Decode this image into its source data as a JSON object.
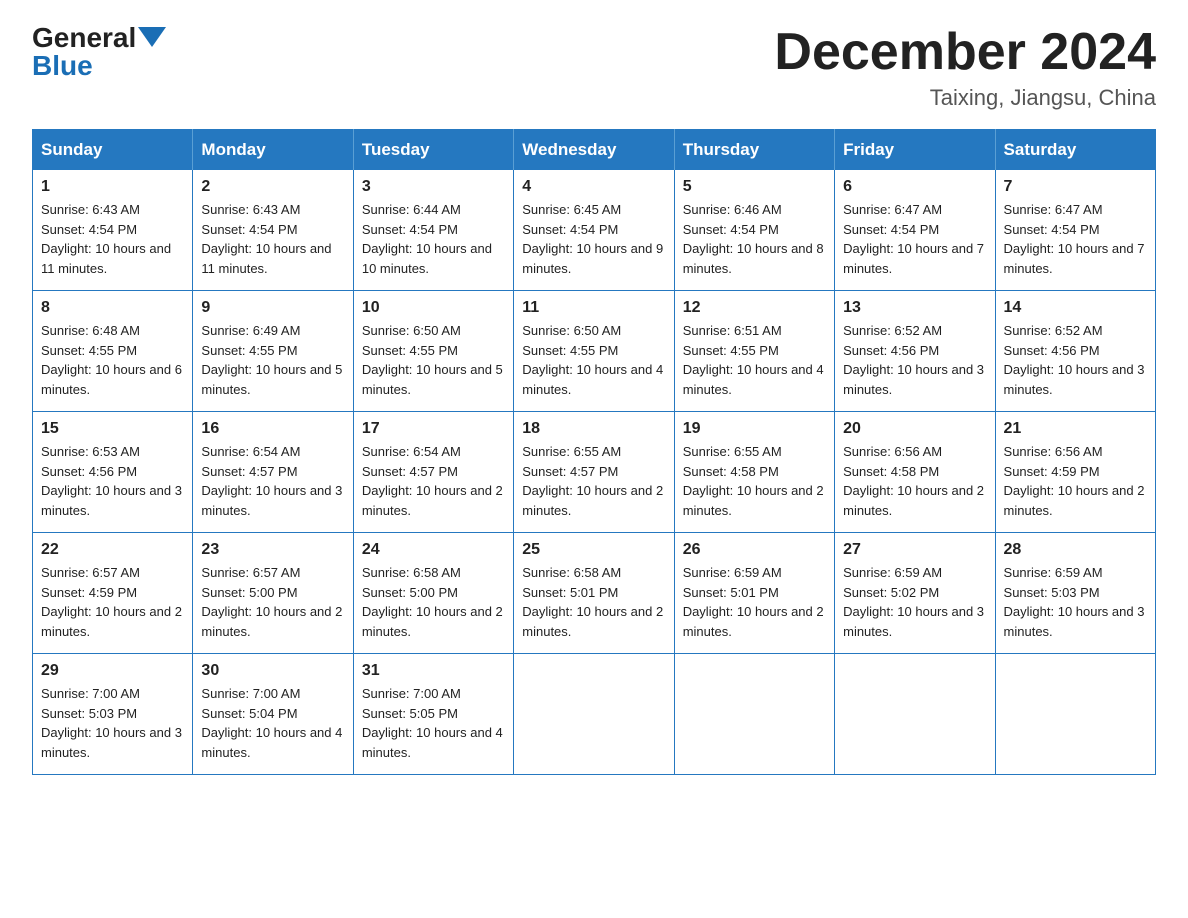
{
  "header": {
    "logo_general": "General",
    "logo_blue": "Blue",
    "month_title": "December 2024",
    "location": "Taixing, Jiangsu, China"
  },
  "weekdays": [
    "Sunday",
    "Monday",
    "Tuesday",
    "Wednesday",
    "Thursday",
    "Friday",
    "Saturday"
  ],
  "weeks": [
    [
      {
        "day": "1",
        "sunrise": "6:43 AM",
        "sunset": "4:54 PM",
        "daylight": "10 hours and 11 minutes."
      },
      {
        "day": "2",
        "sunrise": "6:43 AM",
        "sunset": "4:54 PM",
        "daylight": "10 hours and 11 minutes."
      },
      {
        "day": "3",
        "sunrise": "6:44 AM",
        "sunset": "4:54 PM",
        "daylight": "10 hours and 10 minutes."
      },
      {
        "day": "4",
        "sunrise": "6:45 AM",
        "sunset": "4:54 PM",
        "daylight": "10 hours and 9 minutes."
      },
      {
        "day": "5",
        "sunrise": "6:46 AM",
        "sunset": "4:54 PM",
        "daylight": "10 hours and 8 minutes."
      },
      {
        "day": "6",
        "sunrise": "6:47 AM",
        "sunset": "4:54 PM",
        "daylight": "10 hours and 7 minutes."
      },
      {
        "day": "7",
        "sunrise": "6:47 AM",
        "sunset": "4:54 PM",
        "daylight": "10 hours and 7 minutes."
      }
    ],
    [
      {
        "day": "8",
        "sunrise": "6:48 AM",
        "sunset": "4:55 PM",
        "daylight": "10 hours and 6 minutes."
      },
      {
        "day": "9",
        "sunrise": "6:49 AM",
        "sunset": "4:55 PM",
        "daylight": "10 hours and 5 minutes."
      },
      {
        "day": "10",
        "sunrise": "6:50 AM",
        "sunset": "4:55 PM",
        "daylight": "10 hours and 5 minutes."
      },
      {
        "day": "11",
        "sunrise": "6:50 AM",
        "sunset": "4:55 PM",
        "daylight": "10 hours and 4 minutes."
      },
      {
        "day": "12",
        "sunrise": "6:51 AM",
        "sunset": "4:55 PM",
        "daylight": "10 hours and 4 minutes."
      },
      {
        "day": "13",
        "sunrise": "6:52 AM",
        "sunset": "4:56 PM",
        "daylight": "10 hours and 3 minutes."
      },
      {
        "day": "14",
        "sunrise": "6:52 AM",
        "sunset": "4:56 PM",
        "daylight": "10 hours and 3 minutes."
      }
    ],
    [
      {
        "day": "15",
        "sunrise": "6:53 AM",
        "sunset": "4:56 PM",
        "daylight": "10 hours and 3 minutes."
      },
      {
        "day": "16",
        "sunrise": "6:54 AM",
        "sunset": "4:57 PM",
        "daylight": "10 hours and 3 minutes."
      },
      {
        "day": "17",
        "sunrise": "6:54 AM",
        "sunset": "4:57 PM",
        "daylight": "10 hours and 2 minutes."
      },
      {
        "day": "18",
        "sunrise": "6:55 AM",
        "sunset": "4:57 PM",
        "daylight": "10 hours and 2 minutes."
      },
      {
        "day": "19",
        "sunrise": "6:55 AM",
        "sunset": "4:58 PM",
        "daylight": "10 hours and 2 minutes."
      },
      {
        "day": "20",
        "sunrise": "6:56 AM",
        "sunset": "4:58 PM",
        "daylight": "10 hours and 2 minutes."
      },
      {
        "day": "21",
        "sunrise": "6:56 AM",
        "sunset": "4:59 PM",
        "daylight": "10 hours and 2 minutes."
      }
    ],
    [
      {
        "day": "22",
        "sunrise": "6:57 AM",
        "sunset": "4:59 PM",
        "daylight": "10 hours and 2 minutes."
      },
      {
        "day": "23",
        "sunrise": "6:57 AM",
        "sunset": "5:00 PM",
        "daylight": "10 hours and 2 minutes."
      },
      {
        "day": "24",
        "sunrise": "6:58 AM",
        "sunset": "5:00 PM",
        "daylight": "10 hours and 2 minutes."
      },
      {
        "day": "25",
        "sunrise": "6:58 AM",
        "sunset": "5:01 PM",
        "daylight": "10 hours and 2 minutes."
      },
      {
        "day": "26",
        "sunrise": "6:59 AM",
        "sunset": "5:01 PM",
        "daylight": "10 hours and 2 minutes."
      },
      {
        "day": "27",
        "sunrise": "6:59 AM",
        "sunset": "5:02 PM",
        "daylight": "10 hours and 3 minutes."
      },
      {
        "day": "28",
        "sunrise": "6:59 AM",
        "sunset": "5:03 PM",
        "daylight": "10 hours and 3 minutes."
      }
    ],
    [
      {
        "day": "29",
        "sunrise": "7:00 AM",
        "sunset": "5:03 PM",
        "daylight": "10 hours and 3 minutes."
      },
      {
        "day": "30",
        "sunrise": "7:00 AM",
        "sunset": "5:04 PM",
        "daylight": "10 hours and 4 minutes."
      },
      {
        "day": "31",
        "sunrise": "7:00 AM",
        "sunset": "5:05 PM",
        "daylight": "10 hours and 4 minutes."
      },
      null,
      null,
      null,
      null
    ]
  ],
  "labels": {
    "sunrise": "Sunrise:",
    "sunset": "Sunset:",
    "daylight": "Daylight:"
  }
}
